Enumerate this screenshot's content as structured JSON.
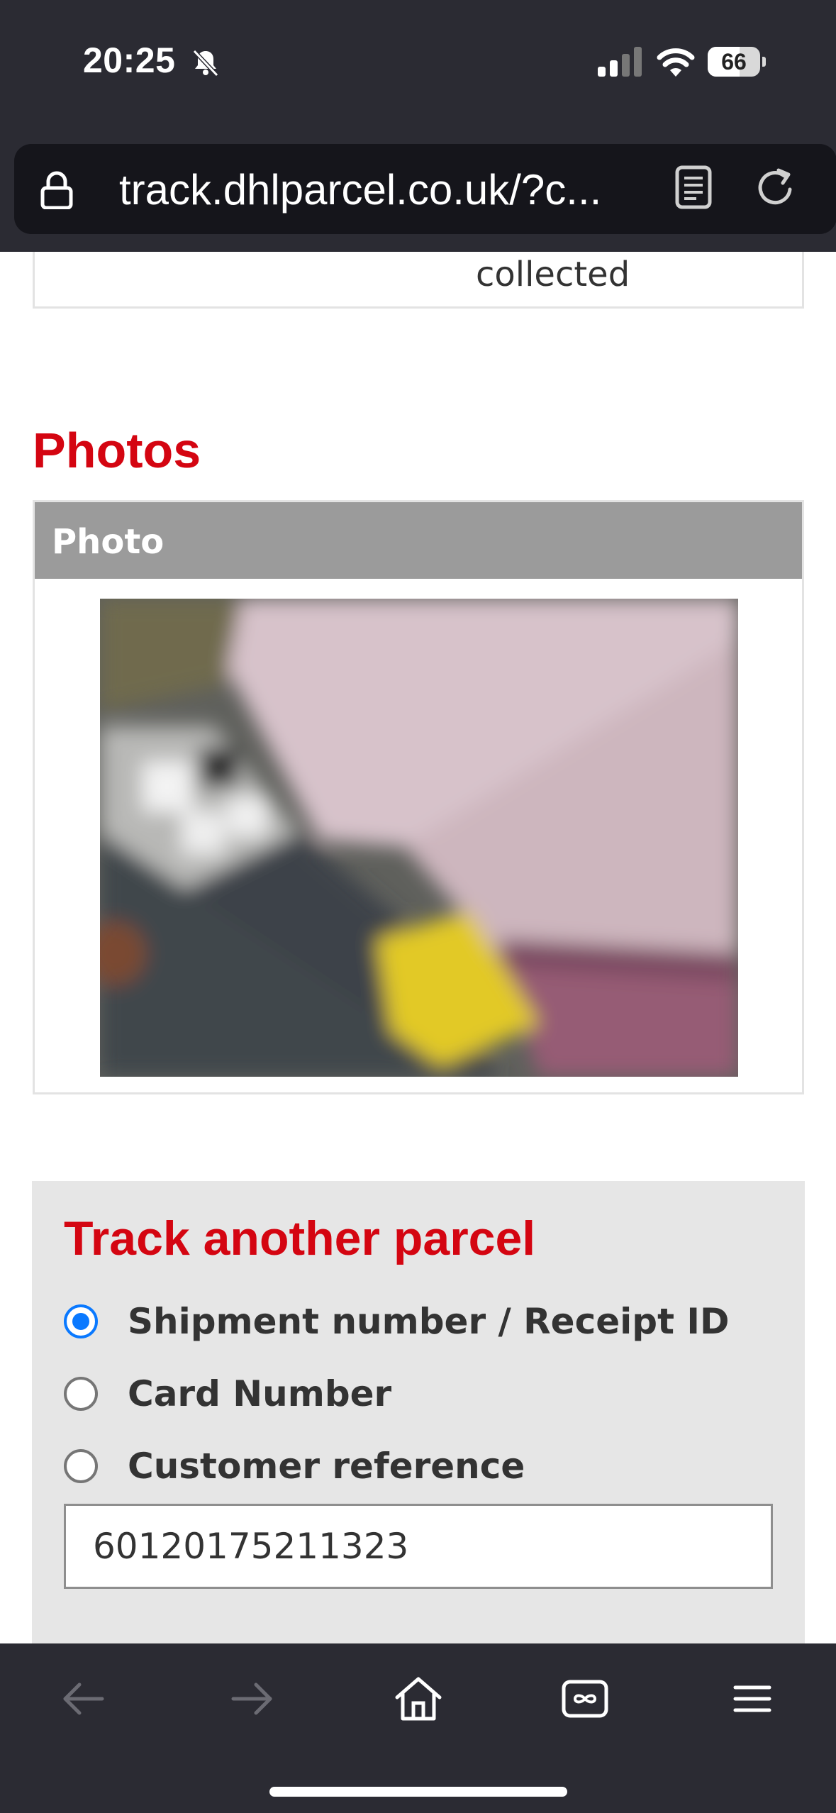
{
  "status_bar": {
    "time": "20:25",
    "battery_level": "66",
    "icons": [
      "bell-slash-icon",
      "cellular-signal-icon",
      "wifi-icon",
      "battery-icon"
    ]
  },
  "browser": {
    "url": "track.dhlparcel.co.uk/?c...",
    "icons": [
      "lock-icon",
      "reader-mode-icon",
      "reload-icon"
    ]
  },
  "previous_section": {
    "status_text": "collected"
  },
  "photos": {
    "title": "Photos",
    "column_header": "Photo"
  },
  "track_another": {
    "title": "Track another parcel",
    "options": [
      {
        "label": "Shipment number / Receipt ID",
        "checked": true
      },
      {
        "label": "Card Number",
        "checked": false
      },
      {
        "label": "Customer reference",
        "checked": false
      }
    ],
    "input_value": "60120175211323"
  },
  "toolbar": {
    "icons": [
      "back-arrow-icon",
      "forward-arrow-icon",
      "home-icon",
      "tabs-icon",
      "menu-icon"
    ]
  },
  "colors": {
    "brand_red": "#d40511",
    "chrome_dark": "#2b2b33",
    "radio_blue": "#0a79ff",
    "table_header_grey": "#9b9b9b",
    "panel_grey": "#e6e6e6"
  }
}
